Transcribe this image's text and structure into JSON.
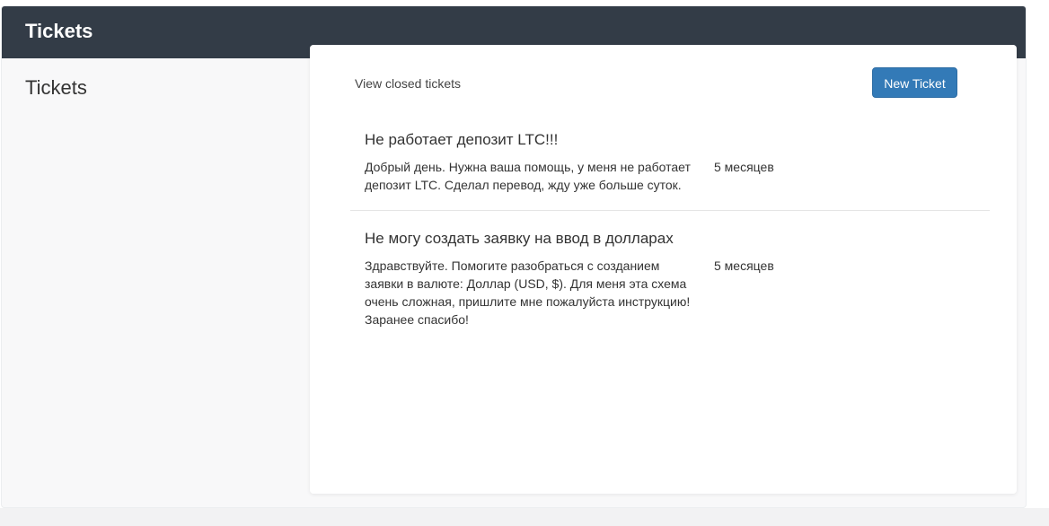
{
  "header": {
    "title": "Tickets"
  },
  "sidebar": {
    "title": "Tickets"
  },
  "toolbar": {
    "closed_link": "View closed tickets",
    "new_ticket_label": "New Ticket"
  },
  "tickets": [
    {
      "title": "Не работает депозит LTC!!!",
      "body": "Добрый день. Нужна ваша помощь, у меня не работает депозит LTC. Сделал перевод, жду уже больше суток.",
      "age": "5 месяцев"
    },
    {
      "title": "Не могу создать заявку на ввод в долларах",
      "body": "Здравствуйте. Помогите разобраться с созданием заявки в валюте: Доллар (USD, $). Для меня эта схема очень сложная, пришлите мне пожалуйста инструкцию! Заранее спасибо!",
      "age": "5 месяцев"
    }
  ],
  "colors": {
    "header_bg": "#333c47",
    "accent": "#337ab7"
  }
}
